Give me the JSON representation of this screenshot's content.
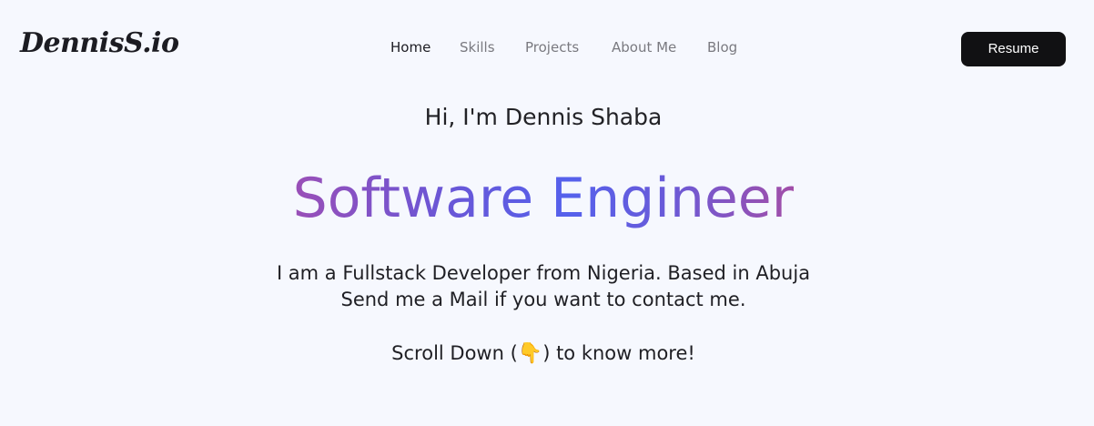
{
  "header": {
    "logo": "DennisS.io",
    "nav": [
      {
        "label": "Home",
        "active": true
      },
      {
        "label": "Skills",
        "active": false
      },
      {
        "label": "Projects",
        "active": false
      },
      {
        "label": "About Me",
        "active": false
      },
      {
        "label": "Blog",
        "active": false
      }
    ],
    "resume_label": "Resume"
  },
  "hero": {
    "greeting": "Hi, I'm Dennis Shaba",
    "role": "Software Engineer",
    "intro_line1": "I am a Fullstack Developer from Nigeria. Based in Abuja",
    "intro_line2": "Send me a Mail if you want to contact me.",
    "scroll_before": "Scroll Down (",
    "scroll_emoji": "👇",
    "scroll_after": ") to know more!"
  },
  "colors": {
    "background": "#f6f8fe",
    "button": "#111113",
    "gradient_start": "#9a4fb7",
    "gradient_mid": "#5561ec",
    "gradient_end": "#a24ea8"
  }
}
